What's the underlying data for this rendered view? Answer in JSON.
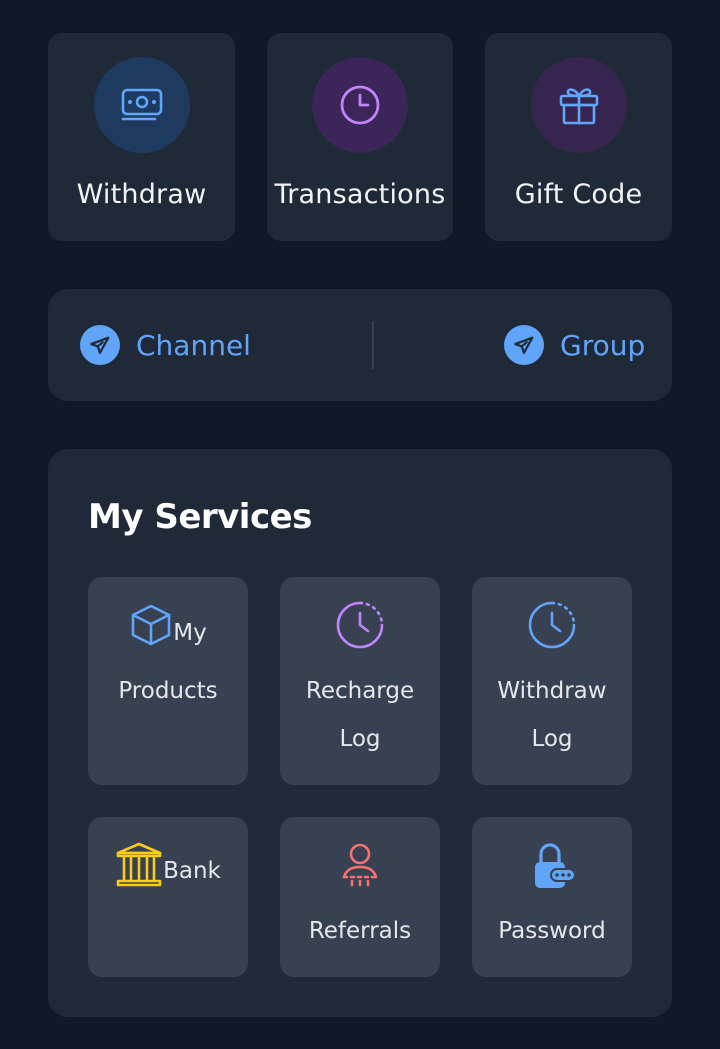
{
  "quick_actions": {
    "withdraw": {
      "label": "Withdraw",
      "icon": "banknote-icon",
      "color": "#60a5fa",
      "bg": "#1e3a5f"
    },
    "transactions": {
      "label": "Transactions",
      "icon": "clock-icon",
      "color": "#c084fc",
      "bg": "#3b2559"
    },
    "gift_code": {
      "label": "Gift Code",
      "icon": "gift-icon",
      "color": "#60a5fa",
      "bg": "#36264f"
    }
  },
  "community": {
    "channel": {
      "label": "Channel",
      "icon": "telegram-icon"
    },
    "group": {
      "label": "Group",
      "icon": "telegram-icon"
    },
    "accent": "#60a5fa"
  },
  "services": {
    "title": "My Services",
    "items": {
      "my_products": {
        "label_line1": "My",
        "label_line2": "Products",
        "icon": "box-icon",
        "color": "#60a5fa"
      },
      "recharge_log": {
        "label_line1": "Recharge",
        "label_line2": "Log",
        "icon": "clock-dashed-icon",
        "color": "#c084fc"
      },
      "withdraw_log": {
        "label_line1": "Withdraw",
        "label_line2": "Log",
        "icon": "clock-dashed-icon",
        "color": "#60a5fa"
      },
      "bank": {
        "label": "Bank",
        "icon": "bank-icon",
        "color": "#facc15"
      },
      "referrals": {
        "label": "Referrals",
        "icon": "user-icon",
        "color": "#f87171"
      },
      "password": {
        "label": "Password",
        "icon": "lock-icon",
        "color": "#60a5fa"
      }
    }
  }
}
